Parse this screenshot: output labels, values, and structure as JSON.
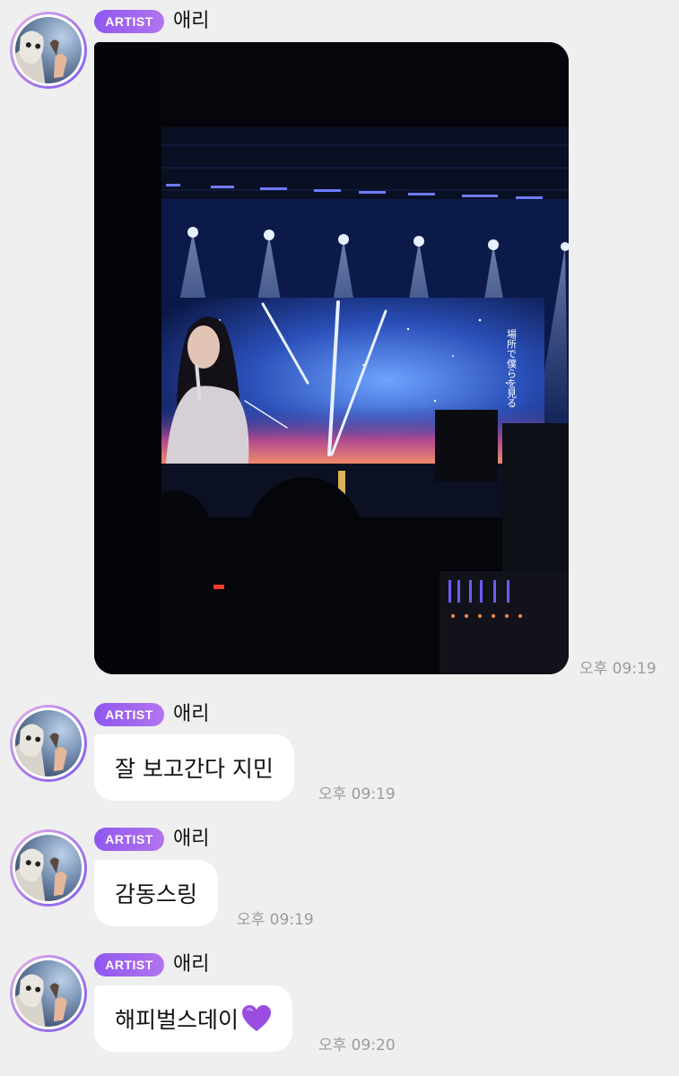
{
  "messages": [
    {
      "badge": "ARTIST",
      "sender": "애리",
      "type": "image",
      "image_alt": "Concert stage photo with a large screen showing a singer holding a microphone against a starry blue sky backdrop",
      "screen_text": "場所で僕らを見る",
      "time": "오후 09:19"
    },
    {
      "badge": "ARTIST",
      "sender": "애리",
      "type": "text",
      "text": "잘 보고간다 지민",
      "time": "오후 09:19"
    },
    {
      "badge": "ARTIST",
      "sender": "애리",
      "type": "text",
      "text": "감동스링",
      "time": "오후 09:19"
    },
    {
      "badge": "ARTIST",
      "sender": "애리",
      "type": "text",
      "text": "해피벌스데이",
      "emoji": "purple-heart",
      "time": "오후 09:20"
    }
  ],
  "colors": {
    "background": "#efeff0",
    "badge_start": "#8f57f0",
    "badge_end": "#b374ee",
    "timestamp": "#9b9ba0",
    "heart": "#9b4de0"
  }
}
